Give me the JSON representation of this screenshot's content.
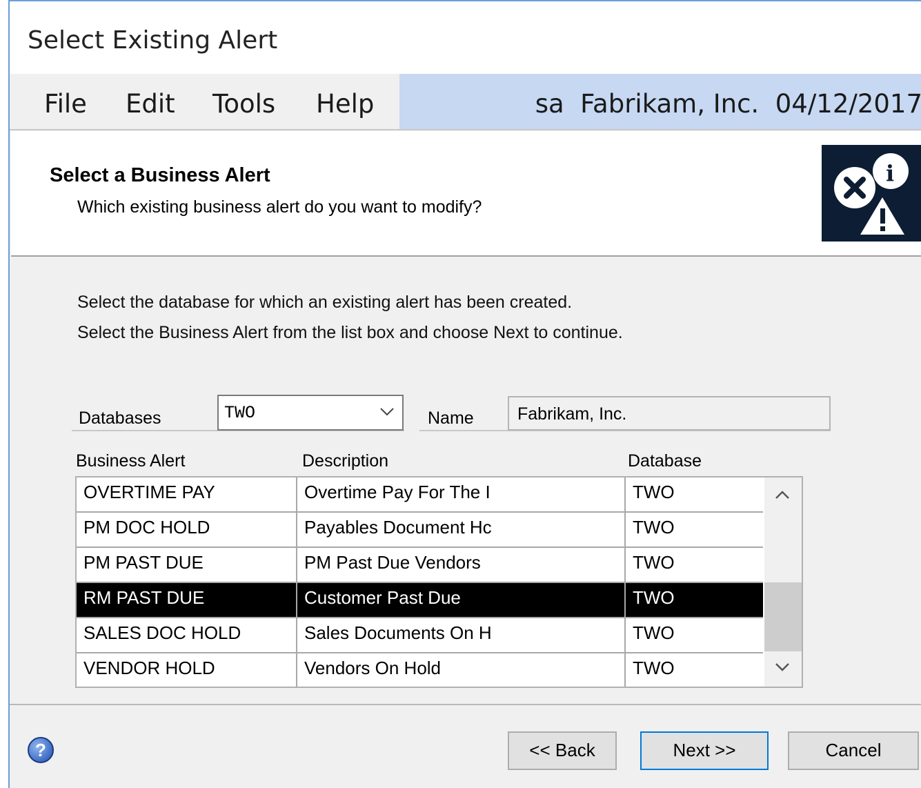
{
  "window": {
    "title": "Select Existing Alert"
  },
  "menu": {
    "items": [
      "File",
      "Edit",
      "Tools",
      "Help"
    ]
  },
  "status": {
    "user": "sa",
    "company": "Fabrikam, Inc.",
    "date": "04/12/2017"
  },
  "header": {
    "title": "Select a Business Alert",
    "subtitle": "Which existing business alert do you want to modify?",
    "icon": "alert-icon"
  },
  "instructions": {
    "line1": "Select the database for which an existing alert has been created.",
    "line2": "Select the Business Alert from the list box and choose Next to continue."
  },
  "form": {
    "databases_label": "Databases",
    "databases_value": "TWO",
    "name_label": "Name",
    "name_value": "Fabrikam, Inc."
  },
  "table": {
    "columns": [
      "Business Alert",
      "Description",
      "Database"
    ],
    "rows": [
      {
        "alert": "OVERTIME PAY",
        "description": "Overtime Pay For The I",
        "database": "TWO",
        "selected": false
      },
      {
        "alert": "PM DOC HOLD",
        "description": "Payables Document Hc",
        "database": "TWO",
        "selected": false
      },
      {
        "alert": "PM PAST DUE",
        "description": "PM Past Due Vendors",
        "database": "TWO",
        "selected": false
      },
      {
        "alert": "RM PAST DUE",
        "description": "Customer Past Due",
        "database": "TWO",
        "selected": true
      },
      {
        "alert": "SALES DOC HOLD",
        "description": "Sales Documents On H",
        "database": "TWO",
        "selected": false
      },
      {
        "alert": "VENDOR HOLD",
        "description": "Vendors On Hold",
        "database": "TWO",
        "selected": false
      }
    ]
  },
  "buttons": {
    "back": "<< Back",
    "next": "Next >>",
    "cancel": "Cancel"
  },
  "colors": {
    "menu_status_bg": "#c6d8f2",
    "selection_bg": "#000000",
    "default_button_border": "#0078d7"
  }
}
